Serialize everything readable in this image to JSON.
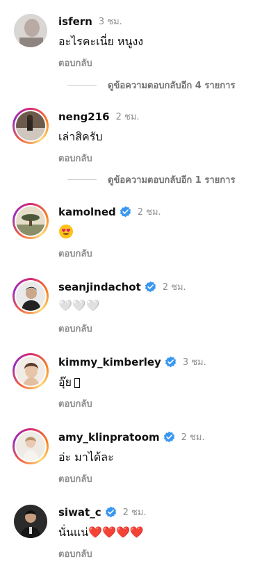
{
  "comments": [
    {
      "username": "isfern",
      "time": "3 ชม.",
      "text": "อะไรคะเนี่ย หนูงง",
      "reply": "ตอบกลับ",
      "verified": false
    },
    {
      "username": "neng216",
      "time": "2 ชม.",
      "text": "เล่าสิครับ",
      "reply": "ตอบกลับ",
      "verified": false
    },
    {
      "username": "kamolned",
      "time": "2 ชม.",
      "text": "",
      "emoji": "heart-eyes-emoji",
      "reply": "ตอบกลับ",
      "verified": true
    },
    {
      "username": "seanjindachot",
      "time": "2 ชม.",
      "text": "🤍🤍🤍",
      "reply": "ตอบกลับ",
      "verified": true
    },
    {
      "username": "kimmy_kimberley",
      "time": "3 ชม.",
      "text": "อุ๊ย",
      "reply": "ตอบกลับ",
      "verified": true
    },
    {
      "username": "amy_klinpratoom",
      "time": "2 ชม.",
      "text": "อ่ะ มาได้ละ",
      "reply": "ตอบกลับ",
      "verified": true
    },
    {
      "username": "siwat_c",
      "time": "2 ชม.",
      "text": "นั่นแน่❤️❤️❤️❤️",
      "reply": "ตอบกลับ",
      "verified": true
    }
  ],
  "view_more_replies": [
    "ดูข้อความตอบกลับอีก 4 รายการ",
    "ดูข้อความตอบกลับอีก 1 รายการ"
  ],
  "colors": {
    "verified": "#3897f0",
    "muted": "#8e8e8e",
    "heart": "#e0245e"
  }
}
